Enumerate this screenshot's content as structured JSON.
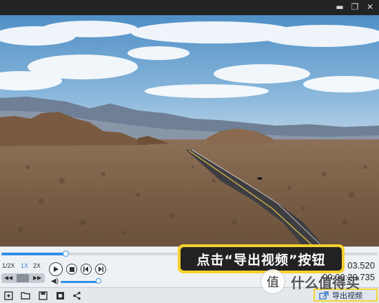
{
  "window": {
    "minimize_glyph": "▬",
    "restore_glyph": "❐",
    "close_glyph": "✕"
  },
  "playback": {
    "progress_fraction": 0.17,
    "speeds": [
      "1/2X",
      "1X",
      "2X"
    ],
    "active_speed": "1X",
    "volume_fraction": 0.95
  },
  "timecodes": {
    "current": "03.520",
    "total": "00:00:20.735"
  },
  "toolbar": {
    "export_label": "导出视频",
    "icons": [
      "film-add-icon",
      "folder-open-icon",
      "save-icon",
      "trim-icon",
      "share-icon"
    ]
  },
  "annotation": {
    "callout_text": "点击“导出视频”按钮"
  },
  "watermark": {
    "logo_glyph": "值",
    "text": "什么值得买"
  },
  "colors": {
    "accent": "#2f8fe6",
    "callout_border": "#f5d12c",
    "callout_bg": "#222222"
  }
}
